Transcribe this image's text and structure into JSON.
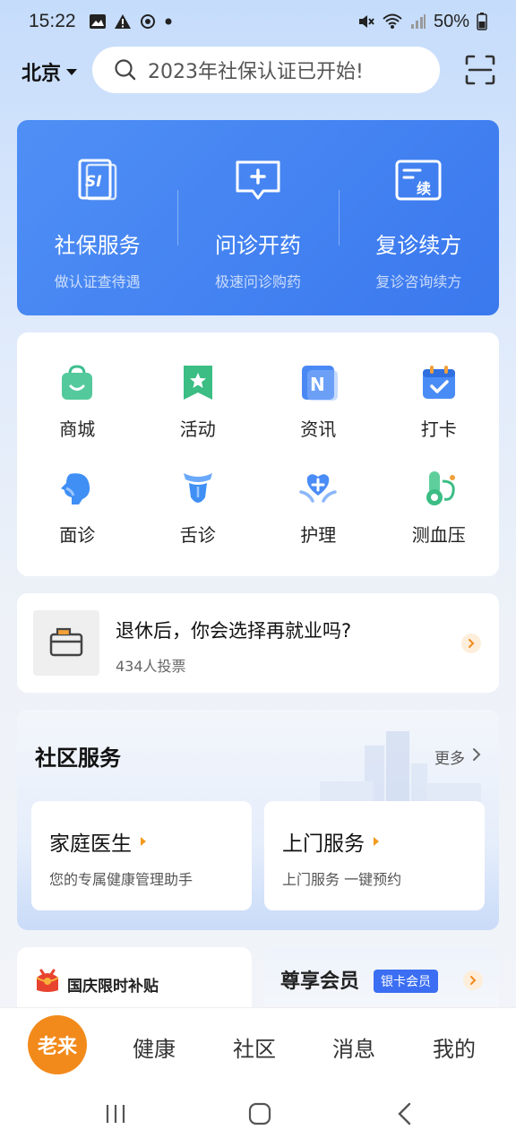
{
  "status_bar": {
    "time": "15:22",
    "battery": "50%",
    "left_icons": [
      "image-icon",
      "alert-icon",
      "sync-icon",
      "dot-icon"
    ],
    "right_icons": [
      "mute-icon",
      "wifi-icon",
      "signal-icon",
      "battery-icon"
    ]
  },
  "header": {
    "city": "北京",
    "search_placeholder": "2023年社保认证已开始!",
    "scan_icon": "scan-icon"
  },
  "banner": {
    "services": [
      {
        "title": "社保服务",
        "subtitle": "做认证查待遇",
        "icon": "social-security-icon"
      },
      {
        "title": "问诊开药",
        "subtitle": "极速问诊购药",
        "icon": "consult-icon"
      },
      {
        "title": "复诊续方",
        "subtitle": "复诊咨询续方",
        "icon": "renew-prescription-icon"
      }
    ]
  },
  "grid": {
    "items": [
      {
        "label": "商城",
        "icon": "shop-bag-icon",
        "color": "#3fbf8f"
      },
      {
        "label": "活动",
        "icon": "star-bookmark-icon",
        "color": "#2eb872"
      },
      {
        "label": "资讯",
        "icon": "news-n-icon",
        "color": "#3d7ff2"
      },
      {
        "label": "打卡",
        "icon": "calendar-check-icon",
        "color": "#3d8af7"
      },
      {
        "label": "面诊",
        "icon": "face-profile-icon",
        "color": "#3d8af7"
      },
      {
        "label": "舌诊",
        "icon": "tongue-icon",
        "color": "#3d8af7"
      },
      {
        "label": "护理",
        "icon": "heart-hand-icon",
        "color": "#3d8af7"
      },
      {
        "label": "测血压",
        "icon": "thermometer-icon",
        "color": "#2eb872"
      }
    ]
  },
  "poll": {
    "question": "退休后，你会选择再就业吗?",
    "votes": "434人投票"
  },
  "community": {
    "title": "社区服务",
    "more": "更多",
    "cards": [
      {
        "title": "家庭医生",
        "subtitle": "您的专属健康管理助手"
      },
      {
        "title": "上门服务",
        "subtitle": "上门服务 一键预约"
      }
    ]
  },
  "promo": {
    "left_text": "国庆限时补贴",
    "right_title": "尊享会员",
    "right_badge": "银卡会员"
  },
  "tabbar": {
    "home": "老来",
    "tabs": [
      "健康",
      "社区",
      "消息",
      "我的"
    ]
  },
  "colors": {
    "accent_blue": "#3a78ee",
    "accent_orange": "#f28a1b"
  }
}
